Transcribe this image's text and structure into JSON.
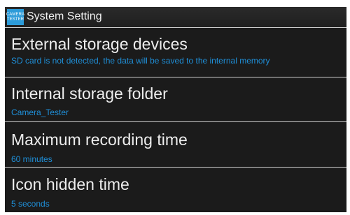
{
  "header": {
    "app_icon_line1": "CAMERA",
    "app_icon_line2": "TESTER",
    "title": "System Setting"
  },
  "settings": [
    {
      "title": "External storage devices",
      "value": "SD card is not detected, the data will be saved to the internal memory"
    },
    {
      "title": "Internal storage folder",
      "value": "Camera_Tester"
    },
    {
      "title": "Maximum recording time",
      "value": "60 minutes"
    },
    {
      "title": "Icon hidden time",
      "value": "5 seconds"
    }
  ],
  "colors": {
    "background": "#1b1b1b",
    "title_text": "#ededed",
    "value_text": "#1f8fd8",
    "icon_bg": "#2c9bd9",
    "divider": "#cfcfcf"
  }
}
